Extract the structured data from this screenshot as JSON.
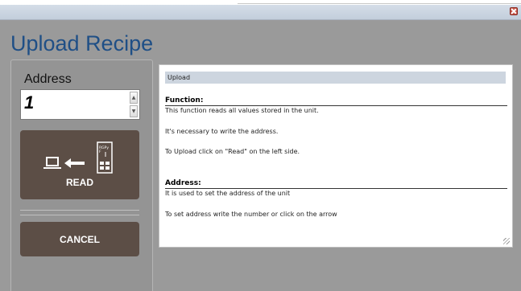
{
  "window": {
    "title": "Upload Recipe"
  },
  "address": {
    "label": "Address",
    "value": "1"
  },
  "buttons": {
    "read": "READ",
    "cancel": "CANCEL"
  },
  "device_icon_text": "RGPy\nF",
  "help": {
    "header": "Upload",
    "sections": [
      {
        "heading": "Function:",
        "lines": [
          "This function reads all values stored in the unit.",
          "It's necessary to write the address.",
          "To Upload click on \"Read\" on the left side."
        ]
      },
      {
        "heading": "Address:",
        "lines": [
          "It is used to set the address of the unit",
          "To set address write the number or click on the arrow"
        ]
      }
    ]
  },
  "colors": {
    "button": "#5c4e46",
    "title": "#1f4f86",
    "background": "#9a9a9a"
  }
}
